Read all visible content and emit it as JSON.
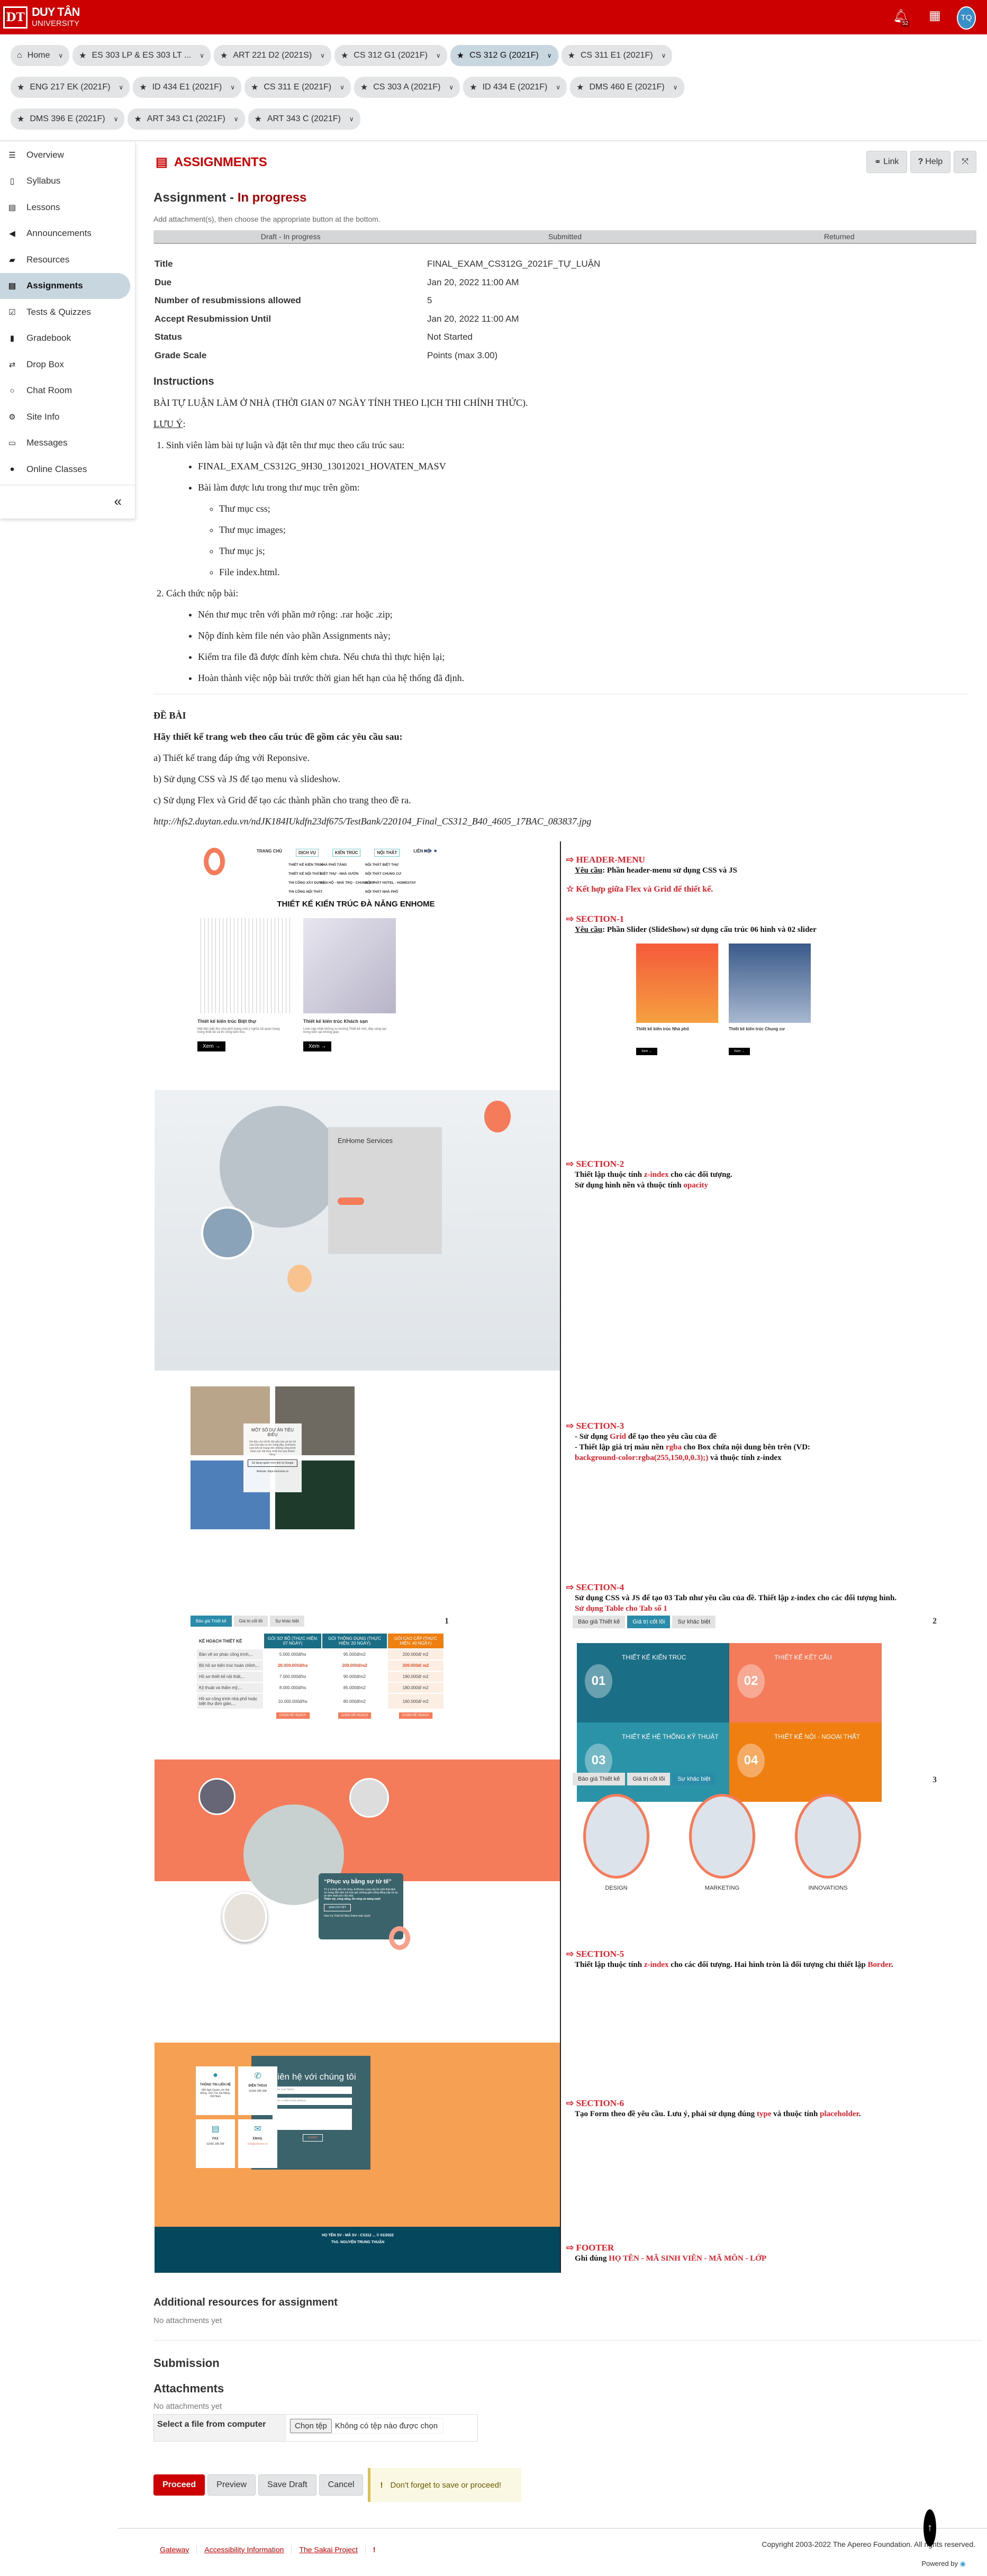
{
  "header": {
    "logo_mark": "DT",
    "logo_name": "DUY TÂN",
    "logo_sub": "UNIVERSITY",
    "notification_count": "52",
    "avatar": "TQ",
    "brand_color": "#cc0000"
  },
  "site_tabs": [
    [
      {
        "label": "Home",
        "icon": "home-icon"
      },
      {
        "label": "ES 303 LP & ES 303 LT ...",
        "icon": "star-icon"
      },
      {
        "label": "ART 221 D2 (2021S)",
        "icon": "star-icon"
      },
      {
        "label": "CS 312 G1 (2021F)",
        "icon": "star-icon"
      },
      {
        "label": "CS 312 G (2021F)",
        "icon": "star-icon",
        "active": true
      },
      {
        "label": "CS 311 E1 (2021F)",
        "icon": "star-icon"
      }
    ],
    [
      {
        "label": "ENG 217 EK (2021F)",
        "icon": "star-icon"
      },
      {
        "label": "ID 434 E1 (2021F)",
        "icon": "star-icon"
      },
      {
        "label": "CS 311 E (2021F)",
        "icon": "star-icon"
      },
      {
        "label": "CS 303 A (2021F)",
        "icon": "star-icon"
      },
      {
        "label": "ID 434 E (2021F)",
        "icon": "star-icon"
      },
      {
        "label": "DMS 460 E (2021F)",
        "icon": "star-icon"
      }
    ],
    [
      {
        "label": "DMS 396 E (2021F)",
        "icon": "star-icon"
      },
      {
        "label": "ART 343 C1 (2021F)",
        "icon": "star-icon"
      },
      {
        "label": "ART 343 C (2021F)",
        "icon": "star-icon"
      }
    ]
  ],
  "sidebar": {
    "items": [
      {
        "label": "Overview",
        "icon": "list-icon"
      },
      {
        "label": "Syllabus",
        "icon": "map-icon"
      },
      {
        "label": "Lessons",
        "icon": "file-icon"
      },
      {
        "label": "Announcements",
        "icon": "bullhorn-icon"
      },
      {
        "label": "Resources",
        "icon": "folder-icon"
      },
      {
        "label": "Assignments",
        "icon": "assignment-icon",
        "active": true
      },
      {
        "label": "Tests & Quizzes",
        "icon": "check-square-icon"
      },
      {
        "label": "Gradebook",
        "icon": "book-icon"
      },
      {
        "label": "Drop Box",
        "icon": "exchange-icon"
      },
      {
        "label": "Chat Room",
        "icon": "chat-icon"
      },
      {
        "label": "Site Info",
        "icon": "gear-icon"
      },
      {
        "label": "Messages",
        "icon": "inbox-icon"
      },
      {
        "label": "Online Classes",
        "icon": "globe-icon"
      }
    ],
    "collapse": "«"
  },
  "tool": {
    "title": "ASSIGNMENTS",
    "link": "Link",
    "help": "Help"
  },
  "assignment": {
    "heading": "Assignment",
    "sep": " - ",
    "status": "In progress",
    "hint": "Add attachment(s), then choose the appropriate button at the bottom.",
    "progress": [
      "Draft - In progress",
      "Submitted",
      "Returned"
    ],
    "fields": [
      {
        "k": "Title",
        "v": "FINAL_EXAM_CS312G_2021F_TỰ_LUẬN"
      },
      {
        "k": "Due",
        "v": "Jan 20, 2022 11:00 AM"
      },
      {
        "k": "Number of resubmissions allowed",
        "v": "5"
      },
      {
        "k": "Accept Resubmission Until",
        "v": "Jan 20, 2022 11:00 AM"
      },
      {
        "k": "Status",
        "v": "Not Started"
      },
      {
        "k": "Grade Scale",
        "v": "Points (max 3.00)"
      }
    ]
  },
  "instructions": {
    "heading": "Instructions",
    "intro": "BÀI TỰ LUẬN LÀM Ở NHÀ (THỜI GIAN 07 NGÀY TÍNH THEO LỊCH THI CHÍNH THỨC).",
    "note": "LƯU Ý",
    "note_colon": ":",
    "step1": "Sinh viên làm bài tự luận và đặt tên thư mục theo cấu trúc sau:",
    "folder": "FINAL_EXAM_CS312G_9H30_13012021_HOVATEN_MASV",
    "contains": "Bài làm được lưu trong thư mục trên gồm:",
    "subitems": [
      "Thư mục css;",
      "Thư mục images;",
      "Thư mục js;",
      "File index.html."
    ],
    "step2": "Cách thức nộp bài:",
    "submit_items": [
      "Nén thư mục trên với phần mở rộng: .rar hoặc .zip;",
      "Nộp đính kèm file nén vào phần Assignments này;",
      "Kiểm tra file đã được đính kèm chưa. Nếu chưa thì thực hiện lại;",
      "Hoàn thành việc nộp bài trước thời gian hết hạn của hệ thống đã định."
    ],
    "exam_heading": "ĐỀ BÀI",
    "exam_lead": "Hãy thiết kế trang web theo cấu trúc đề gồm các yêu cầu sau:",
    "reqs": [
      "a) Thiết kế trang đáp ứng với Reponsive.",
      "b) Sử dụng CSS và JS để tạo menu và slideshow.",
      "c) Sử dụng Flex và Grid để tạo các thành phần cho trang theo đề ra."
    ],
    "url": "http://hfs2.duytan.edu.vn/ndJK184IUkdfn23df675/TestBank/220104_Final_CS312_B40_4605_17BAC_083837.jpg"
  },
  "exam_image": {
    "menu": [
      "TRANG CHỦ",
      "DỊCH VỤ",
      "KIẾN TRÚC",
      "NỘI THẤT",
      "LIÊN HỆ"
    ],
    "submenu_dichvu": [
      "THIẾT KẾ KIẾN TRÚC",
      "THIẾT KẾ NỘI THẤT",
      "THI CÔNG XÂY DỰNG",
      "THI CÔNG NỘI THẤT"
    ],
    "submenu_kientruc": [
      "NHÀ PHỐ TẦNG",
      "BIỆT THỰ - NHÀ VƯỜN",
      "CĂN HỘ - NHÀ TRỌ - CHUNG CƯ"
    ],
    "submenu_noithat": [
      "NỘI THẤT BIỆT THỰ",
      "NỘI THẤT CHUNG CƯ",
      "NỘI THẤT HOTEL - HOMESTAY",
      "NỘI THẤT NHÀ PHỐ"
    ],
    "hero_title": "THIẾT KẾ KIẾN TRÚC ĐÀ NẴNG ENHOME",
    "cards": [
      {
        "title": "Thiết kế kiến trúc Biệt thự",
        "text": "Mặt tiền biệt thự nhà phố mang một ý nghĩa rất quan trọng trong thiết kế và thi công kiến trúc."
      },
      {
        "title": "Thiết kế kiến trúc Khách sạn",
        "text": "Luôn cập nhật những xu hướng Thiết kế mới, đầy sáng tạo trong kiến tạo không gian."
      }
    ],
    "view": "Xem →",
    "services_title": "EnHome Services",
    "projects_title": "MỘT SỐ DỰ ÁN TIÊU BIỂU",
    "projects_text": "Với tiêu chí cốt lõi đặt yêu cầu và lợi ích của Chủ đầu tư lên hàng đầu, EnHome cam kết sẽ mang đến những công trình hoàn mỹ, hài lòng nhất cho quý khách hàng.",
    "projects_btn": "Sử dụng nguồn hình ảnh từ Google",
    "projects_site": "Website: https://enhome.vn",
    "tabs": [
      "Báo giá Thiết kế",
      "Giá trị cốt lõi",
      "Sự khác biệt"
    ],
    "table_head": [
      "KẾ HOẠCH THIẾT KẾ",
      "GÓI SƠ BỘ (THỰC HIỆN: 07 NGÀY)",
      "GÓI THÔNG DỤNG (THỰC HIỆN: 20 NGÀY)",
      "GÓI CAO CẤP (THỰC HIỆN: 40 NGÀY)"
    ],
    "table_rows": [
      [
        "Bản vẽ sơ phác công trình,...",
        "5.000.000đ/hs",
        "95.000đ/m2",
        "200.000đ/ m2"
      ],
      [
        "Bộ hồ sơ kiến trúc hoàn chỉnh,...",
        "20.000.000đ/hs",
        "200.000đ/m2",
        "300.000đ/ m2"
      ],
      [
        "Hồ sơ thiết kế nội thất,...",
        "7.000.000đ/hs",
        "90.000đ/m2",
        "190.000đ/ m2"
      ],
      [
        "Kỹ thuật và thẩm mỹ,...",
        "8.000.000đ/hs",
        "85.000đ/m2",
        "180.000đ/ m2"
      ],
      [
        "Hồ sơ công trình nhà phố hoặc biệt thự đơn giản,...",
        "10.000.000đ/hs",
        "80.000đ/m2",
        "160.000đ/ m2"
      ]
    ],
    "choose_plan": "CHỌN KẾ HOẠCH",
    "tab_numbers": [
      "1",
      "2",
      "3"
    ],
    "quote_title": "“Phục vụ bằng sự tử tế”",
    "quote_text": "Từ ý tưởng đến thi công, EnHome cung cấp hệ sinh thái dịch vụ mang đến tiện ích trọn gói, không gian sống đẳng cấp và sự an tâm nhất cho chủ nhà.",
    "quote_bold": "Thẩm mỹ, công năng, thi công và mảng xanh",
    "quote_btn": "XEM CHI TIẾT",
    "quote_foot": "Dịch Vụ Thiết Kế Nhà Online toàn Quốc",
    "contact_cards": [
      {
        "title": "THÔNG TIN LIÊN HỆ",
        "text": "995 Ngô Quyền, An Hải Đông, Sơn Trà, Đà Nẵng, Việt Nam",
        "icon": "map-pin-icon"
      },
      {
        "title": "ĐIỆN THOẠI",
        "text": "02366 288 288",
        "icon": "phone-icon"
      },
      {
        "title": "FAX",
        "text": "02366 288 288",
        "icon": "fax-icon"
      },
      {
        "title": "EMAIL",
        "text": "info@enhome.vn",
        "icon": "envelope-icon"
      }
    ],
    "form_title": "Liên hệ với chúng tôi",
    "name_ph": "Enter your Name",
    "email_ph": "Enter a valid email address",
    "submit": "SUBMIT",
    "footer": [
      "HỌ TÊN SV - MÃ SV - CS312 ... © 01/2022",
      "ThS. NGUYỄN TRUNG THUẬN"
    ],
    "slider_captions": [
      "Thiết kế kiến trúc Nhà phố",
      "Thiết kế kiến trúc Chung cư"
    ],
    "values": [
      {
        "n": "01",
        "t": "THIẾT KẾ KIẾN TRÚC",
        "c": "#1a6f87"
      },
      {
        "n": "02",
        "t": "THIẾT KẾ KẾT CẤU",
        "c": "#f47c5a"
      },
      {
        "n": "03",
        "t": "THIẾT KẾ HỆ THỐNG KỸ THUẬT",
        "c": "#2a93a8"
      },
      {
        "n": "04",
        "t": "THIẾT KẾ NỘI - NGOẠI THẤT",
        "c": "#f07f12"
      }
    ],
    "diffs": [
      "DESIGN",
      "MARKETING",
      "INNOVATIONS"
    ],
    "annotations": {
      "header_menu": "HEADER-MENU",
      "req_label": "Yêu cầu",
      "header_req": ": Phần header-menu sử dụng CSS và JS",
      "star": "Kết hợp giữa Flex và Grid để thiết kế.",
      "s1": "SECTION-1",
      "s1_req": ": Phần Slider (SlideShow) sử dụng cấu trúc 06 hình và 02 slider",
      "s2": "SECTION-2",
      "s2_a": "Thiết lập thuộc tính ",
      "s2_b": "z-index",
      "s2_c": " cho các đối tượng.",
      "s2_d": "Sử dụng hình nền và thuộc tính ",
      "s2_e": "opacity",
      "s3": "SECTION-3",
      "s3_a": "- Sử dụng ",
      "s3_b": "Grid",
      "s3_c": " để tạo theo yêu cầu của đề",
      "s3_d": "- Thiết lập giá trị màu nền ",
      "s3_e": "rgba",
      "s3_f": " cho Box chứa nội dung bên trên (VD: ",
      "s3_g": "background-color:rgba(255,150,0,0.3);)",
      "s3_h": " và thuộc tính z-index",
      "s4": "SECTION-4",
      "s4_a": "Sử dụng CSS và JS để tạo 03 Tab như yêu cầu của đề. Thiết lập z-index cho các đối tượng hình.",
      "s4_b": "Sử dụng Table cho Tab số 1",
      "s5": "SECTION-5",
      "s5_a": "Thiết lập thuộc tính ",
      "s5_b": "z-index",
      "s5_c": " cho các đối tượng. Hai hình tròn là đối tượng chỉ thiết lập ",
      "s5_d": "Border",
      "s5_e": ".",
      "s6": "SECTION-6",
      "s6_a": "Tạo Form theo đề yêu cầu. Lưu ý, phải sử dụng đúng ",
      "s6_b": "type",
      "s6_c": " và thuộc tính ",
      "s6_d": "placeholder",
      "s6_e": ".",
      "footer": "FOOTER",
      "footer_a": "Ghi đúng ",
      "footer_b": "HỌ TÊN - MÃ SINH VIÊN - MÃ MÔN - LỚP"
    }
  },
  "resources": {
    "heading": "Additional resources for assignment",
    "empty": "No attachments yet"
  },
  "submission": {
    "heading": "Submission",
    "attachments": "Attachments",
    "empty": "No attachments yet",
    "file_label": "Select a file from computer",
    "file_button": "Chọn tệp",
    "file_none": "Không có tệp nào được chọn"
  },
  "actions": {
    "proceed": "Proceed",
    "preview": "Preview",
    "save_draft": "Save Draft",
    "cancel": "Cancel",
    "alert": "Don't forget to save or proceed!"
  },
  "footer": {
    "links": [
      "Gateway",
      "Accessibility Information",
      "The Sakai Project"
    ],
    "copyright": "Copyright 2003-2022 The Apereo Foundation. All rights reserved.",
    "powered": "Powered by"
  }
}
